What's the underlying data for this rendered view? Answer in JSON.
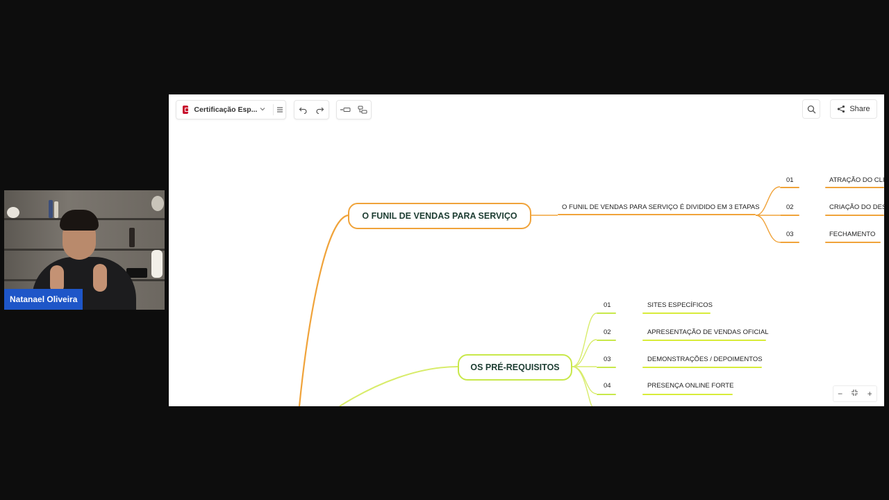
{
  "presenter": {
    "name": "Natanael Oliveira"
  },
  "toolbar": {
    "doc_title": "Certificação Esp...",
    "share_label": "Share"
  },
  "mindmap": {
    "branch1": {
      "title": "O FUNIL DE VENDAS PARA SERVIÇO",
      "subtitle": "O FUNIL DE VENDAS PARA SERVIÇO É DIVIDIDO EM 3 ETAPAS",
      "items": [
        {
          "num": "01",
          "label": "ATRAÇÃO DO CLIE"
        },
        {
          "num": "02",
          "label": "CRIAÇÃO DO DESE"
        },
        {
          "num": "03",
          "label": "FECHAMENTO"
        }
      ]
    },
    "branch2": {
      "title": "OS PRÉ-REQUISITOS",
      "items": [
        {
          "num": "01",
          "label": "SITES ESPECÍFICOS"
        },
        {
          "num": "02",
          "label": "APRESENTAÇÃO DE VENDAS OFICIAL"
        },
        {
          "num": "03",
          "label": "DEMONSTRAÇÕES / DEPOIMENTOS"
        },
        {
          "num": "04",
          "label": "PRESENÇA ONLINE FORTE"
        }
      ]
    }
  },
  "colors": {
    "orange": "#f0a33a",
    "lime": "#c8e84a",
    "brand": "#c8102e",
    "tag": "#1e56c8"
  }
}
